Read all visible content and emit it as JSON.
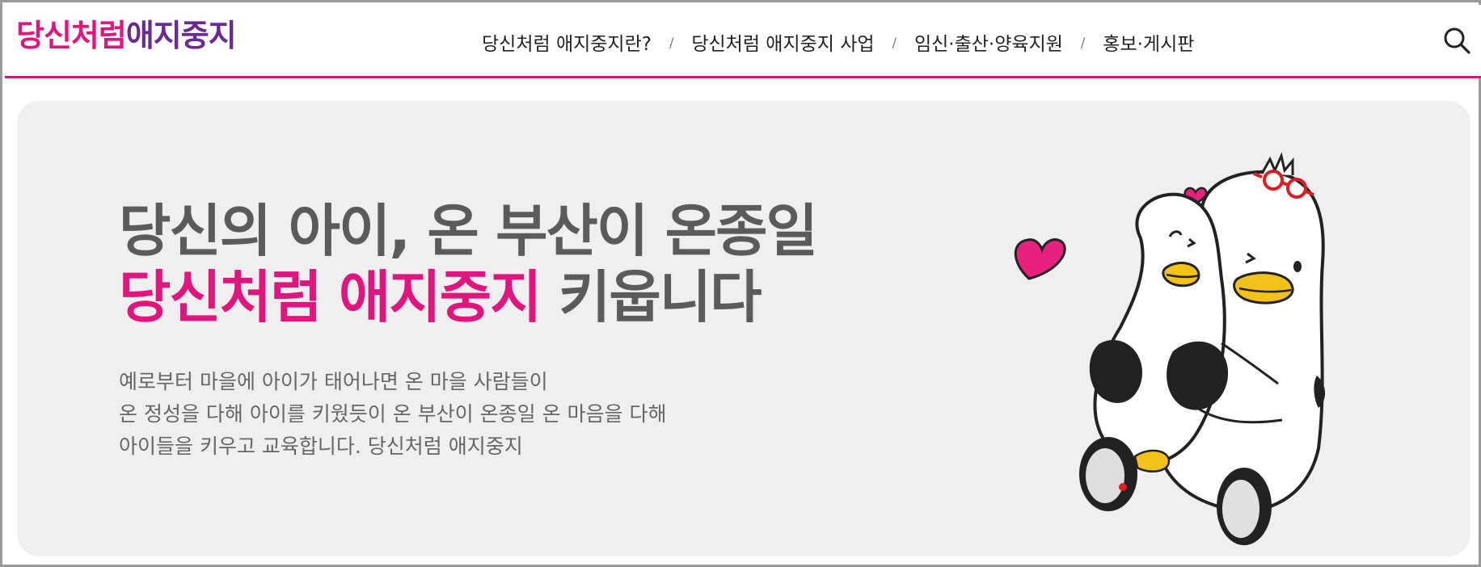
{
  "header": {
    "logo": {
      "part1": "당신처럼",
      "part2": "애지중지"
    },
    "nav": [
      {
        "label": "당신처럼 애지중지란?"
      },
      {
        "label": "당신처럼 애지중지 사업"
      },
      {
        "label": "임신·출산·양육지원"
      },
      {
        "label": "홍보·게시판"
      }
    ],
    "separator": "/",
    "search_icon": "search-icon"
  },
  "hero": {
    "headline_line1": "당신의 아이, 온 부산이 온종일",
    "headline_line2_highlight": "당신처럼 애지중지",
    "headline_line2_rest": " 키웁니다",
    "description": [
      "예로부터 마을에 아이가 태어나면 온 마을 사람들이",
      "온 정성을 다해 아이를 키웠듯이 온 부산이 온종일 온 마음을 다해",
      "아이들을 키우고 교육합니다. 당신처럼 애지중지"
    ]
  },
  "colors": {
    "accent_pink": "#e0157d",
    "accent_purple": "#6a2a92",
    "hero_bg": "#efefef",
    "heart_pink": "#e8217f",
    "beak_yellow": "#f2c21a"
  }
}
